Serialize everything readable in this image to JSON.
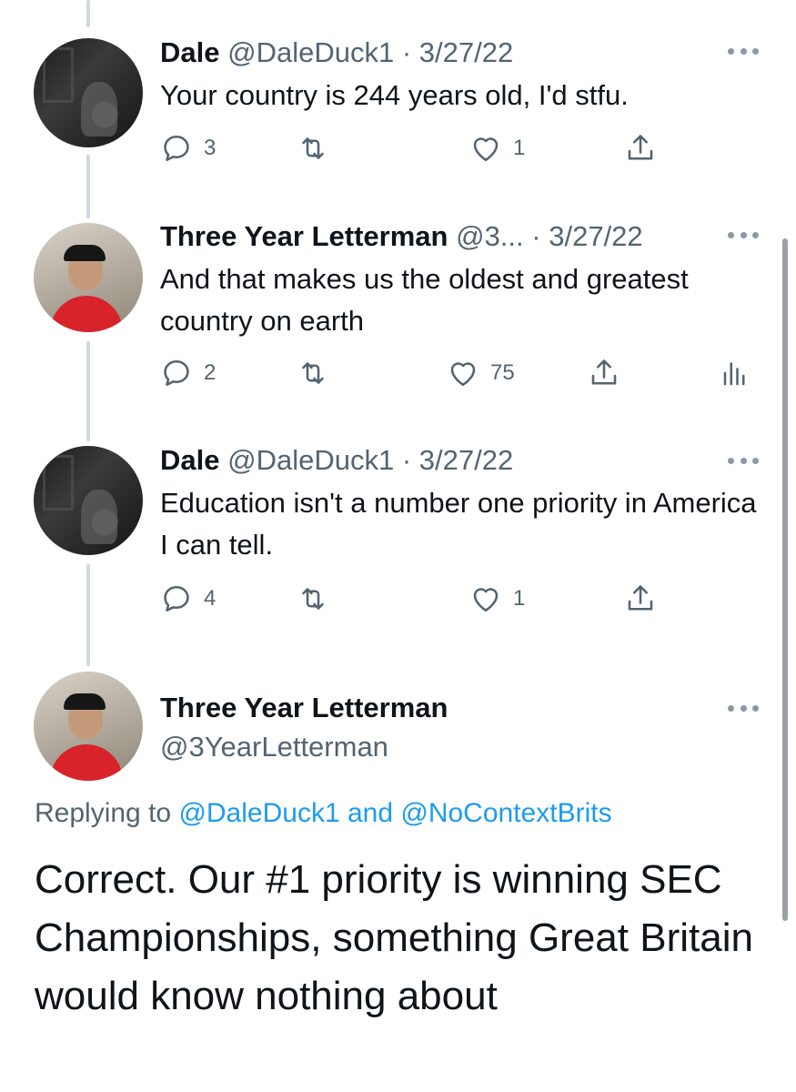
{
  "tweets": [
    {
      "name": "Dale",
      "handle": "@DaleDuck1",
      "separator": "·",
      "date": "3/27/22",
      "text": "Your country is 244 years old, I'd stfu.",
      "replies": "3",
      "likes": "1",
      "avatar_icon": "avatar-dark-photo"
    },
    {
      "name": "Three Year Letterman",
      "handle": "@3...",
      "separator": "·",
      "date": "3/27/22",
      "text": "And that makes us the oldest and greatest country on earth",
      "replies": "2",
      "likes": "75",
      "avatar_icon": "avatar-red-shirt-photo"
    },
    {
      "name": "Dale",
      "handle": "@DaleDuck1",
      "separator": "·",
      "date": "3/27/22",
      "text": "Education isn't a number one priority in America I can tell.",
      "replies": "4",
      "likes": "1",
      "avatar_icon": "avatar-dark-photo"
    }
  ],
  "main_tweet": {
    "name": "Three Year Letterman",
    "handle": "@3YearLetterman",
    "replying_prefix": "Replying to",
    "replying_to_1": "@DaleDuck1",
    "replying_and": "and",
    "replying_to_2": "@NoContextBrits",
    "text": "Correct. Our #1 priority is winning SEC Championships, something Great Britain would know nothing about"
  },
  "colors": {
    "text": "#0f1419",
    "secondary": "#536471",
    "link": "#1d9bf0",
    "thread_line": "#cfd9de"
  }
}
